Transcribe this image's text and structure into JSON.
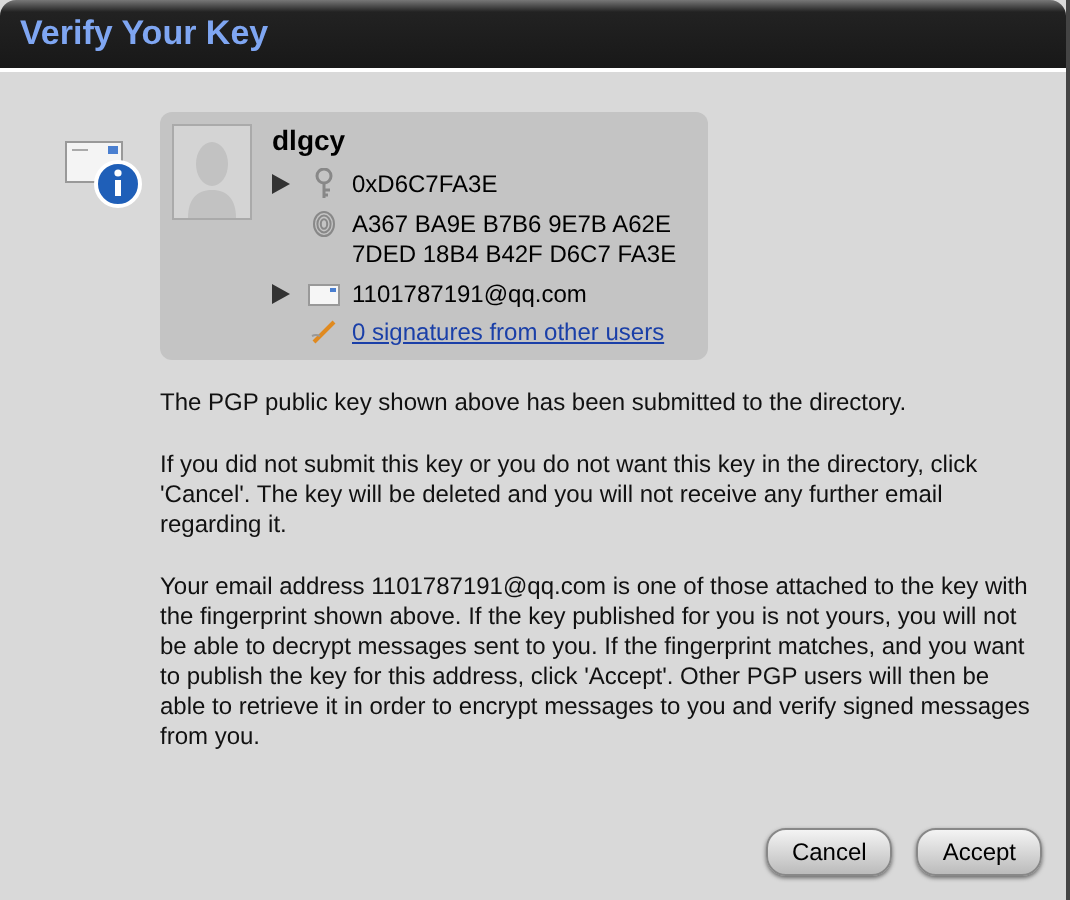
{
  "window": {
    "title": "Verify Your Key"
  },
  "key": {
    "name": "dlgcy",
    "key_id": "0xD6C7FA3E",
    "fingerprint": [
      "A367 BA9E B7B6 9E7B A62E",
      "7DED 18B4 B42F D6C7 FA3E"
    ],
    "email": "1101787191@qq.com",
    "signatures_link": "0 signatures from other users",
    "key_id_expanded": false,
    "email_expanded": false
  },
  "paragraphs": [
    "The PGP public key shown above has been submitted to the directory.",
    "If you did not submit this key or you do not want this key in the directory, click 'Cancel'. The key will be deleted and you will not receive any further email regarding it.",
    "Your email address 1101787191@qq.com is one of those attached to the key with the fingerprint shown above. If the key published for you is not yours, you will not be able to decrypt messages sent to you. If the fingerprint matches, and you want to publish the key for this address, click 'Accept'. Other PGP users will then be able to retrieve it in order to encrypt messages to you and verify signed messages from you."
  ],
  "buttons": [
    "Cancel",
    "Accept"
  ]
}
